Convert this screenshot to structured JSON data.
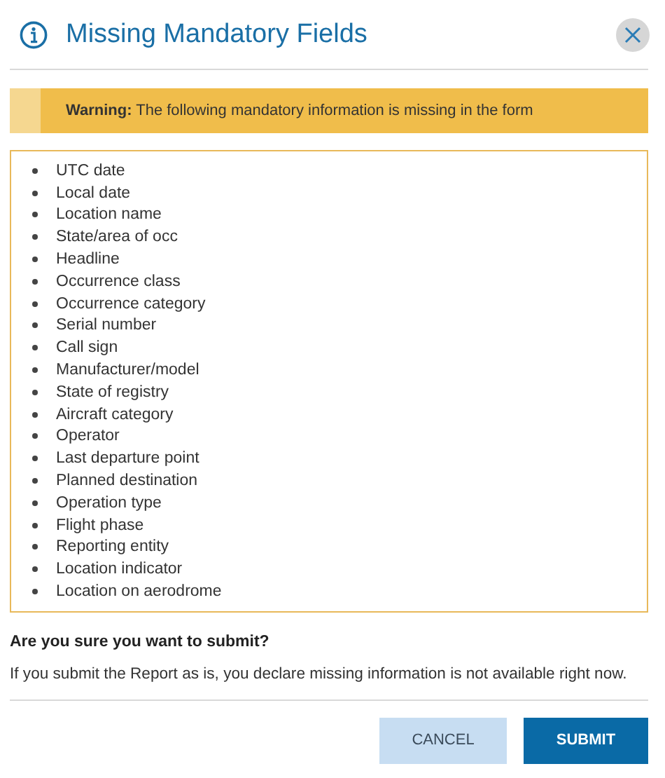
{
  "dialog": {
    "title": "Missing Mandatory Fields"
  },
  "warning": {
    "label": "Warning:",
    "text": "The following mandatory information is missing in the form"
  },
  "missing_fields": [
    "UTC date",
    "Local date",
    "Location name",
    "State/area of occ",
    "Headline",
    "Occurrence class",
    "Occurrence category",
    "Serial number",
    "Call sign",
    "Manufacturer/model",
    "State of registry",
    "Aircraft category",
    "Operator",
    "Last departure point",
    "Planned destination",
    "Operation type",
    "Flight phase",
    "Reporting entity",
    "Location indicator",
    "Location on aerodrome"
  ],
  "question": "Are you sure you want to submit?",
  "note": "If you submit the Report as is, you declare missing information is not available right now.",
  "buttons": [
    {
      "label": "CANCEL",
      "kind": "secondary"
    },
    {
      "label": "SUBMIT",
      "kind": "primary"
    }
  ]
}
